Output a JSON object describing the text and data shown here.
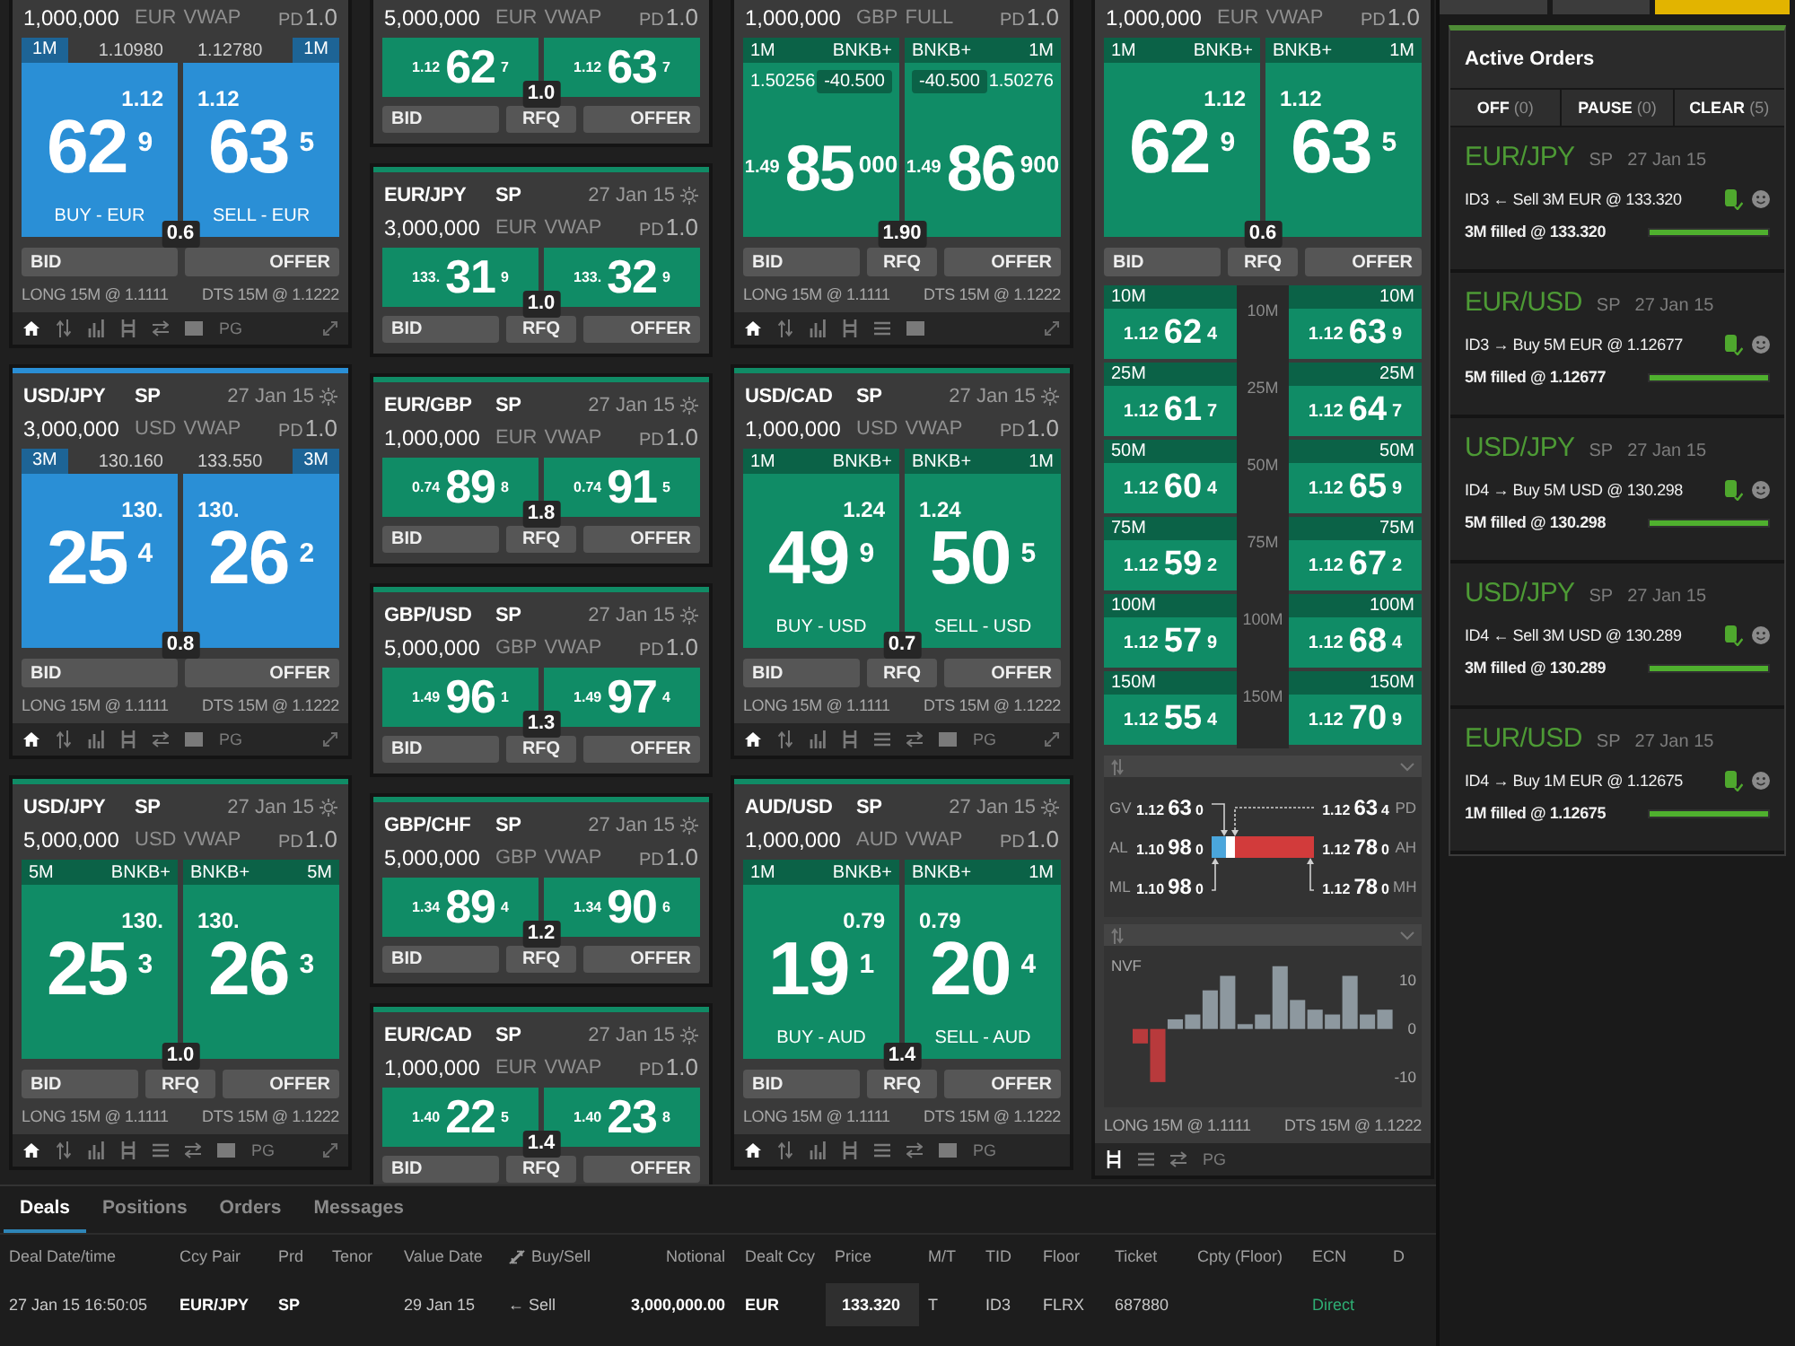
{
  "columns": [
    {
      "tiles": [
        {
          "kind": "esp",
          "color": "#2a8fd6",
          "notional": "1,000,000",
          "currency": "EUR",
          "mode": "VWAP",
          "pd": "PD",
          "pd_value": "1.0",
          "sides": [
            {
              "size": "1M",
              "rate": "1.10980",
              "figure": "1.12",
              "pips": "62",
              "frac": "9",
              "action": "BUY - EUR"
            },
            {
              "size": "1M",
              "rate": "1.12780",
              "figure": "1.12",
              "pips": "63",
              "frac": "5",
              "action": "SELL - EUR"
            }
          ],
          "spread": "0.6",
          "buttons": [
            "BID",
            "OFFER"
          ],
          "position": "LONG 15M @ 1.1111",
          "dts": "DTS 15M @ 1.1222",
          "toolbar": [
            {
              "kind": "home",
              "selected": true
            },
            {
              "kind": "arrows",
              "selected": false
            },
            {
              "kind": "bars",
              "selected": false
            },
            {
              "kind": "ladder",
              "selected": false
            },
            {
              "kind": "scale",
              "selected": false
            },
            {
              "kind": "block",
              "selected": false
            },
            {
              "kind": "text",
              "label": "PG",
              "selected": false
            }
          ],
          "expand": true
        },
        {
          "kind": "esp",
          "color": "#2a8fd6",
          "pair": "USD/JPY",
          "tenor": "SP",
          "date": "27 Jan 15",
          "notional": "3,000,000",
          "currency": "USD",
          "mode": "VWAP",
          "pd": "PD",
          "pd_value": "1.0",
          "sides": [
            {
              "size": "3M",
              "rate": "130.160",
              "figure": "130.",
              "pips": "25",
              "frac": "4"
            },
            {
              "size": "3M",
              "rate": "133.550",
              "figure": "130.",
              "pips": "26",
              "frac": "2"
            }
          ],
          "spread": "0.8",
          "buttons": [
            "BID",
            "OFFER"
          ],
          "position": "LONG 15M @ 1.1111",
          "dts": "DTS 15M @ 1.1222",
          "toolbar": [
            {
              "kind": "home",
              "selected": true
            },
            {
              "kind": "arrows",
              "selected": false
            },
            {
              "kind": "bars",
              "selected": false
            },
            {
              "kind": "ladder",
              "selected": false
            },
            {
              "kind": "scale",
              "selected": false
            },
            {
              "kind": "block",
              "selected": false
            },
            {
              "kind": "text",
              "label": "PG",
              "selected": false
            }
          ],
          "expand": true
        },
        {
          "kind": "rfs",
          "color": "#108c66",
          "pair": "USD/JPY",
          "tenor": "SP",
          "date": "27 Jan 15",
          "notional": "5,000,000",
          "currency": "USD",
          "mode": "VWAP",
          "pd": "PD",
          "pd_value": "1.0",
          "sides": [
            {
              "size": "5M",
              "source": "BNKB+",
              "figure": "130.",
              "pips": "25",
              "frac": "3"
            },
            {
              "size": "5M",
              "source": "BNKB+",
              "figure": "130.",
              "pips": "26",
              "frac": "3"
            }
          ],
          "spread": "1.0",
          "buttons": [
            "BID",
            "RFQ",
            "OFFER"
          ],
          "position": "LONG 15M @ 1.1111",
          "dts": "DTS 15M @ 1.1222",
          "toolbar": [
            {
              "kind": "home",
              "selected": true
            },
            {
              "kind": "arrows",
              "selected": false
            },
            {
              "kind": "bars",
              "selected": false
            },
            {
              "kind": "ladder",
              "selected": false
            },
            {
              "kind": "list",
              "selected": false
            },
            {
              "kind": "scale",
              "selected": false
            },
            {
              "kind": "block",
              "selected": false
            },
            {
              "kind": "text",
              "label": "PG",
              "selected": false
            }
          ],
          "expand": true
        }
      ]
    },
    {
      "tiles": [
        {
          "kind": "compact",
          "color": "#108c66",
          "notional": "5,000,000",
          "currency": "EUR",
          "mode": "VWAP",
          "pd": "PD",
          "pd_value": "1.0",
          "sides": [
            {
              "figure": "1.12",
              "pips": "62",
              "frac": "7"
            },
            {
              "figure": "1.12",
              "pips": "63",
              "frac": "7"
            }
          ],
          "spread": "1.0",
          "buttons": [
            "BID",
            "RFQ",
            "OFFER"
          ]
        },
        {
          "kind": "compact",
          "color": "#108c66",
          "pair": "EUR/JPY",
          "tenor": "SP",
          "date": "27 Jan 15",
          "notional": "3,000,000",
          "currency": "EUR",
          "mode": "VWAP",
          "pd": "PD",
          "pd_value": "1.0",
          "sides": [
            {
              "figure": "133.",
              "pips": "31",
              "frac": "9"
            },
            {
              "figure": "133.",
              "pips": "32",
              "frac": "9"
            }
          ],
          "spread": "1.0",
          "buttons": [
            "BID",
            "RFQ",
            "OFFER"
          ]
        },
        {
          "kind": "compact",
          "color": "#108c66",
          "pair": "EUR/GBP",
          "tenor": "SP",
          "date": "27 Jan 15",
          "notional": "1,000,000",
          "currency": "EUR",
          "mode": "VWAP",
          "pd": "PD",
          "pd_value": "1.0",
          "sides": [
            {
              "figure": "0.74",
              "pips": "89",
              "frac": "8"
            },
            {
              "figure": "0.74",
              "pips": "91",
              "frac": "5"
            }
          ],
          "spread": "1.8",
          "buttons": [
            "BID",
            "RFQ",
            "OFFER"
          ]
        },
        {
          "kind": "compact",
          "color": "#108c66",
          "pair": "GBP/USD",
          "tenor": "SP",
          "date": "27 Jan 15",
          "notional": "5,000,000",
          "currency": "GBP",
          "mode": "VWAP",
          "pd": "PD",
          "pd_value": "1.0",
          "sides": [
            {
              "figure": "1.49",
              "pips": "96",
              "frac": "1"
            },
            {
              "figure": "1.49",
              "pips": "97",
              "frac": "4"
            }
          ],
          "spread": "1.3",
          "buttons": [
            "BID",
            "RFQ",
            "OFFER"
          ]
        },
        {
          "kind": "compact",
          "color": "#108c66",
          "pair": "GBP/CHF",
          "tenor": "SP",
          "date": "27 Jan 15",
          "notional": "5,000,000",
          "currency": "GBP",
          "mode": "VWAP",
          "pd": "PD",
          "pd_value": "1.0",
          "sides": [
            {
              "figure": "1.34",
              "pips": "89",
              "frac": "4"
            },
            {
              "figure": "1.34",
              "pips": "90",
              "frac": "6"
            }
          ],
          "spread": "1.2",
          "buttons": [
            "BID",
            "RFQ",
            "OFFER"
          ]
        },
        {
          "kind": "compact",
          "color": "#108c66",
          "pair": "EUR/CAD",
          "tenor": "SP",
          "date": "27 Jan 15",
          "notional": "1,000,000",
          "currency": "EUR",
          "mode": "VWAP",
          "pd": "PD",
          "pd_value": "1.0",
          "sides": [
            {
              "figure": "1.40",
              "pips": "22",
              "frac": "5"
            },
            {
              "figure": "1.40",
              "pips": "23",
              "frac": "8"
            }
          ],
          "spread": "1.4",
          "buttons": [
            "BID",
            "RFQ",
            "OFFER"
          ]
        }
      ]
    },
    {
      "tiles": [
        {
          "kind": "full",
          "color": "#108c66",
          "notional": "1,000,000",
          "currency": "GBP",
          "mode": "FULL",
          "pd": "PD",
          "pd_value": "1.0",
          "sides": [
            {
              "size": "1M",
              "source": "BNKB+",
              "rate": "1.50256",
              "adjust": "-40.500",
              "figure": "1.49",
              "pips": "85",
              "frac": "000"
            },
            {
              "size": "1M",
              "source": "BNKB+",
              "rate": "1.50276",
              "adjust": "-40.500",
              "figure": "1.49",
              "pips": "86",
              "frac": "900"
            }
          ],
          "spread": "1.90",
          "buttons": [
            "BID",
            "RFQ",
            "OFFER"
          ],
          "position": "LONG 15M @ 1.1111",
          "dts": "DTS 15M @ 1.1222",
          "toolbar": [
            {
              "kind": "home",
              "selected": true
            },
            {
              "kind": "arrows",
              "selected": false
            },
            {
              "kind": "bars",
              "selected": false
            },
            {
              "kind": "ladder",
              "selected": false
            },
            {
              "kind": "list",
              "selected": false
            },
            {
              "kind": "block",
              "selected": false
            }
          ],
          "expand": true
        },
        {
          "kind": "rfs",
          "color": "#108c66",
          "pair": "USD/CAD",
          "tenor": "SP",
          "date": "27 Jan 15",
          "notional": "1,000,000",
          "currency": "USD",
          "mode": "VWAP",
          "pd": "PD",
          "pd_value": "1.0",
          "sides": [
            {
              "size": "1M",
              "source": "BNKB+",
              "figure": "1.24",
              "pips": "49",
              "frac": "9",
              "action": "BUY - USD"
            },
            {
              "size": "1M",
              "source": "BNKB+",
              "figure": "1.24",
              "pips": "50",
              "frac": "5",
              "action": "SELL - USD"
            }
          ],
          "spread": "0.7",
          "buttons": [
            "BID",
            "RFQ",
            "OFFER"
          ],
          "position": "LONG 15M @ 1.1111",
          "dts": "DTS 15M @ 1.1222",
          "toolbar": [
            {
              "kind": "home",
              "selected": true
            },
            {
              "kind": "arrows",
              "selected": false
            },
            {
              "kind": "bars",
              "selected": false
            },
            {
              "kind": "ladder",
              "selected": false
            },
            {
              "kind": "list",
              "selected": false
            },
            {
              "kind": "scale",
              "selected": false
            },
            {
              "kind": "block",
              "selected": false
            },
            {
              "kind": "text",
              "label": "PG",
              "selected": false
            }
          ],
          "expand": true
        },
        {
          "kind": "rfs",
          "color": "#108c66",
          "pair": "AUD/USD",
          "tenor": "SP",
          "date": "27 Jan 15",
          "notional": "1,000,000",
          "currency": "AUD",
          "mode": "VWAP",
          "pd": "PD",
          "pd_value": "1.0",
          "sides": [
            {
              "size": "1M",
              "source": "BNKB+",
              "figure": "0.79",
              "pips": "19",
              "frac": "1",
              "action": "BUY - AUD"
            },
            {
              "size": "1M",
              "source": "BNKB+",
              "figure": "0.79",
              "pips": "20",
              "frac": "4",
              "action": "SELL - AUD"
            }
          ],
          "spread": "1.4",
          "buttons": [
            "BID",
            "RFQ",
            "OFFER"
          ],
          "position": "LONG 15M @ 1.1111",
          "dts": "DTS 15M @ 1.1222",
          "toolbar": [
            {
              "kind": "home",
              "selected": true
            },
            {
              "kind": "arrows",
              "selected": false
            },
            {
              "kind": "bars",
              "selected": false
            },
            {
              "kind": "ladder",
              "selected": false
            },
            {
              "kind": "list",
              "selected": false
            },
            {
              "kind": "scale",
              "selected": false
            },
            {
              "kind": "block",
              "selected": false
            },
            {
              "kind": "text",
              "label": "PG",
              "selected": false
            }
          ],
          "expand": false
        }
      ]
    },
    {
      "tiles": [
        {
          "kind": "ladder",
          "color": "#108c66",
          "notional": "1,000,000",
          "currency": "EUR",
          "mode": "VWAP",
          "pd": "PD",
          "pd_value": "1.0",
          "sides": [
            {
              "size": "1M",
              "source": "BNKB+",
              "figure": "1.12",
              "pips": "62",
              "frac": "9"
            },
            {
              "size": "1M",
              "source": "BNKB+",
              "figure": "1.12",
              "pips": "63",
              "frac": "5"
            }
          ],
          "spread": "0.6",
          "buttons": [
            "BID",
            "RFQ",
            "OFFER"
          ],
          "ladder": [
            {
              "label": "10M",
              "bid": {
                "size": "10M",
                "figure": "1.12",
                "pips": "62",
                "frac": "4"
              },
              "offer": {
                "size": "10M",
                "figure": "1.12",
                "pips": "63",
                "frac": "9"
              }
            },
            {
              "label": "25M",
              "bid": {
                "size": "25M",
                "figure": "1.12",
                "pips": "61",
                "frac": "7"
              },
              "offer": {
                "size": "25M",
                "figure": "1.12",
                "pips": "64",
                "frac": "7"
              }
            },
            {
              "label": "50M",
              "bid": {
                "size": "50M",
                "figure": "1.12",
                "pips": "60",
                "frac": "4"
              },
              "offer": {
                "size": "50M",
                "figure": "1.12",
                "pips": "65",
                "frac": "9"
              }
            },
            {
              "label": "75M",
              "bid": {
                "size": "75M",
                "figure": "1.12",
                "pips": "59",
                "frac": "2"
              },
              "offer": {
                "size": "75M",
                "figure": "1.12",
                "pips": "67",
                "frac": "2"
              }
            },
            {
              "label": "100M",
              "bid": {
                "size": "100M",
                "figure": "1.12",
                "pips": "57",
                "frac": "9"
              },
              "offer": {
                "size": "100M",
                "figure": "1.12",
                "pips": "68",
                "frac": "4"
              }
            },
            {
              "label": "150M",
              "bid": {
                "size": "150M",
                "figure": "1.12",
                "pips": "55",
                "frac": "4"
              },
              "offer": {
                "size": "150M",
                "figure": "1.12",
                "pips": "70",
                "frac": "9"
              }
            }
          ],
          "gauge": {
            "level": 0.14,
            "rows": [
              {
                "label": "GV",
                "price": {
                  "figure": "1.12",
                  "pips": "63",
                  "frac": "0"
                },
                "right_price": {
                  "figure": "1.12",
                  "pips": "63",
                  "frac": "4"
                },
                "right_label": "PD"
              },
              {
                "label": "AL",
                "price": {
                  "figure": "1.10",
                  "pips": "98",
                  "frac": "0"
                },
                "right_price": {
                  "figure": "1.12",
                  "pips": "78",
                  "frac": "0"
                },
                "right_label": "AH"
              },
              {
                "label": "ML",
                "price": {
                  "figure": "1.10",
                  "pips": "98",
                  "frac": "0"
                },
                "right_price": {
                  "figure": "1.12",
                  "pips": "78",
                  "frac": "0"
                },
                "right_label": "MH"
              }
            ]
          },
          "flow_chart": {
            "title": "NVF",
            "axis_labels": [
              "10",
              "0",
              "-10"
            ]
          },
          "position": "LONG 15M @ 1.1111",
          "dts": "DTS 15M @ 1.1222",
          "toolbar": [
            {
              "kind": "ladder",
              "selected": true
            },
            {
              "kind": "list",
              "selected": false
            },
            {
              "kind": "scale",
              "selected": false
            },
            {
              "kind": "text",
              "label": "PG",
              "selected": false
            }
          ],
          "expand": false
        }
      ]
    }
  ],
  "right_panel": {
    "tabs": [
      {
        "selected": false
      },
      {
        "selected": false
      },
      {
        "selected": true
      }
    ],
    "orders_panel": {
      "title": "Active Orders",
      "buttons": [
        {
          "label": "OFF",
          "count": "(0)"
        },
        {
          "label": "PAUSE",
          "count": "(0)"
        },
        {
          "label": "CLEAR",
          "count": "(5)"
        }
      ],
      "orders": [
        {
          "pair": "EUR/JPY",
          "tenor": "SP",
          "date": "27 Jan 15",
          "order": "ID3 ← Sell 3M EUR @ 133.320",
          "fill": "3M filled @ 133.320",
          "level": 1
        },
        {
          "pair": "EUR/USD",
          "tenor": "SP",
          "date": "27 Jan 15",
          "order": "ID3 → Buy 5M EUR @ 1.12677",
          "fill": "5M filled @ 1.12677",
          "level": 1
        },
        {
          "pair": "USD/JPY",
          "tenor": "SP",
          "date": "27 Jan 15",
          "order": "ID4 → Buy 5M USD @ 130.298",
          "fill": "5M filled @ 130.298",
          "level": 1
        },
        {
          "pair": "USD/JPY",
          "tenor": "SP",
          "date": "27 Jan 15",
          "order": "ID4 ← Sell 3M USD @ 130.289",
          "fill": "3M filled @ 130.289",
          "level": 1
        },
        {
          "pair": "EUR/USD",
          "tenor": "SP",
          "date": "27 Jan 15",
          "order": "ID4 → Buy 1M EUR @ 1.12675",
          "fill": "1M filled @ 1.12675",
          "level": 1
        }
      ]
    }
  },
  "deals": {
    "tabs": [
      {
        "label": "Deals",
        "selected": true
      },
      {
        "label": "Positions",
        "selected": false
      },
      {
        "label": "Orders",
        "selected": false
      },
      {
        "label": "Messages",
        "selected": false
      }
    ],
    "columns": [
      {
        "label": "Deal Date/time",
        "kind": "plain"
      },
      {
        "label": "Ccy Pair",
        "kind": "bold"
      },
      {
        "label": "Prd",
        "kind": "bold"
      },
      {
        "label": "Tenor",
        "kind": "plain"
      },
      {
        "label": "Value Date",
        "kind": "plain"
      },
      {
        "label": "Buy/Sell",
        "kind": "side"
      },
      {
        "label": "Notional",
        "kind": "number"
      },
      {
        "label": "Dealt Ccy",
        "kind": "bold"
      },
      {
        "label": "Price",
        "kind": "boxed"
      },
      {
        "label": "M/T",
        "kind": "plain"
      },
      {
        "label": "TID",
        "kind": "plain"
      },
      {
        "label": "Floor",
        "kind": "plain"
      },
      {
        "label": "Ticket",
        "kind": "plain"
      },
      {
        "label": "Cpty (Floor)",
        "kind": "plain"
      },
      {
        "label": "ECN",
        "kind": "status"
      },
      {
        "label": "D",
        "kind": "plain"
      }
    ],
    "rows": [
      {
        "cells": [
          "27 Jan 15 16:50:05",
          "EUR/JPY",
          "SP",
          null,
          "29 Jan 15",
          "← Sell",
          "3,000,000.00",
          "EUR",
          "133.320",
          "T",
          "ID3",
          "FLRX",
          "687880",
          null,
          "Direct",
          null
        ]
      }
    ]
  }
}
